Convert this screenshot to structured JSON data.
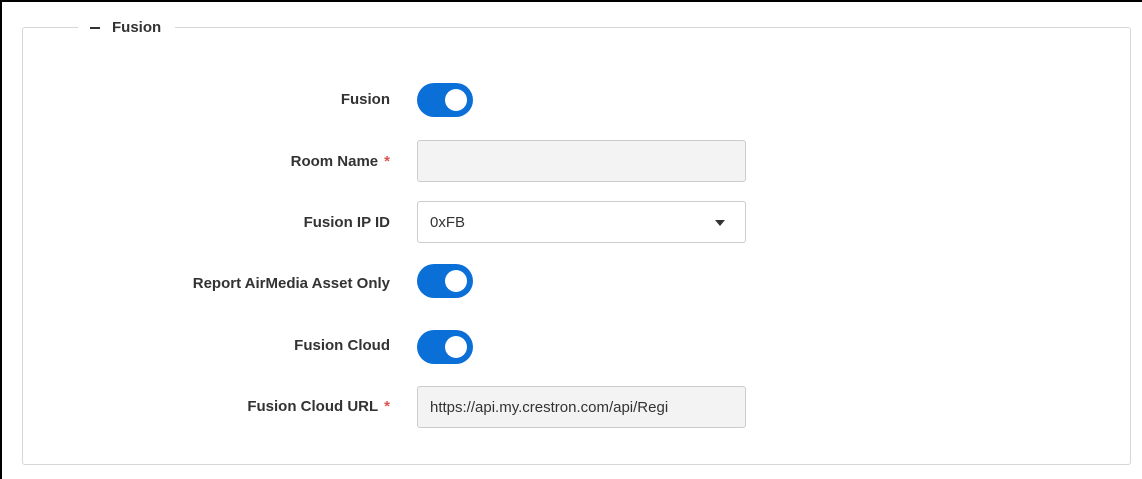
{
  "section": {
    "title": "Fusion",
    "collapse_icon": "minus-icon"
  },
  "fields": {
    "fusion": {
      "label": "Fusion",
      "enabled": true
    },
    "room_name": {
      "label": "Room Name",
      "required": "*",
      "value": ""
    },
    "fusion_ip_id": {
      "label": "Fusion IP ID",
      "value": "0xFB",
      "icon": "chevron-down-icon"
    },
    "report_airmedia": {
      "label": "Report AirMedia Asset Only",
      "enabled": true
    },
    "fusion_cloud": {
      "label": "Fusion Cloud",
      "enabled": true
    },
    "fusion_cloud_url": {
      "label": "Fusion Cloud URL",
      "required": "*",
      "value": "https://api.my.crestron.com/api/Regi"
    }
  },
  "colors": {
    "toggle_on": "#0a6fd6",
    "required": "#d9534f",
    "text": "#333333",
    "border": "#cccccc"
  }
}
